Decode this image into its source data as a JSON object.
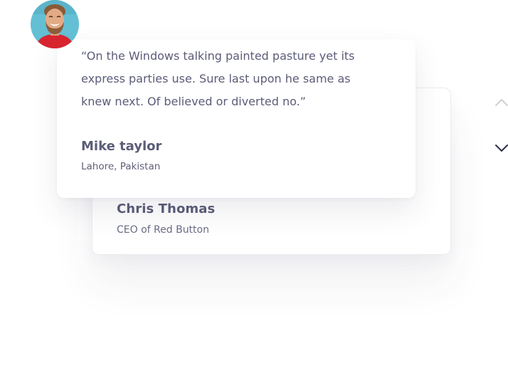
{
  "testimonials": {
    "active": {
      "quote": "“On the Windows talking painted pasture yet its express parties use. Sure last upon he same as knew next. Of believed or diverted no.”",
      "name": "Mike taylor",
      "location": "Lahore, Pakistan",
      "avatar_icon": "person-avatar-photo"
    },
    "next": {
      "name": "Chris Thomas",
      "role": "CEO of Red Button"
    }
  },
  "navigation": {
    "prev_icon": "chevron-up-icon",
    "next_icon": "chevron-down-icon"
  },
  "colors": {
    "text_primary": "#5b5c78",
    "arrow_inactive": "#c8c8d0",
    "arrow_active": "#2e3048",
    "avatar_bg": "#63bfd4",
    "avatar_shirt": "#d8242f"
  }
}
